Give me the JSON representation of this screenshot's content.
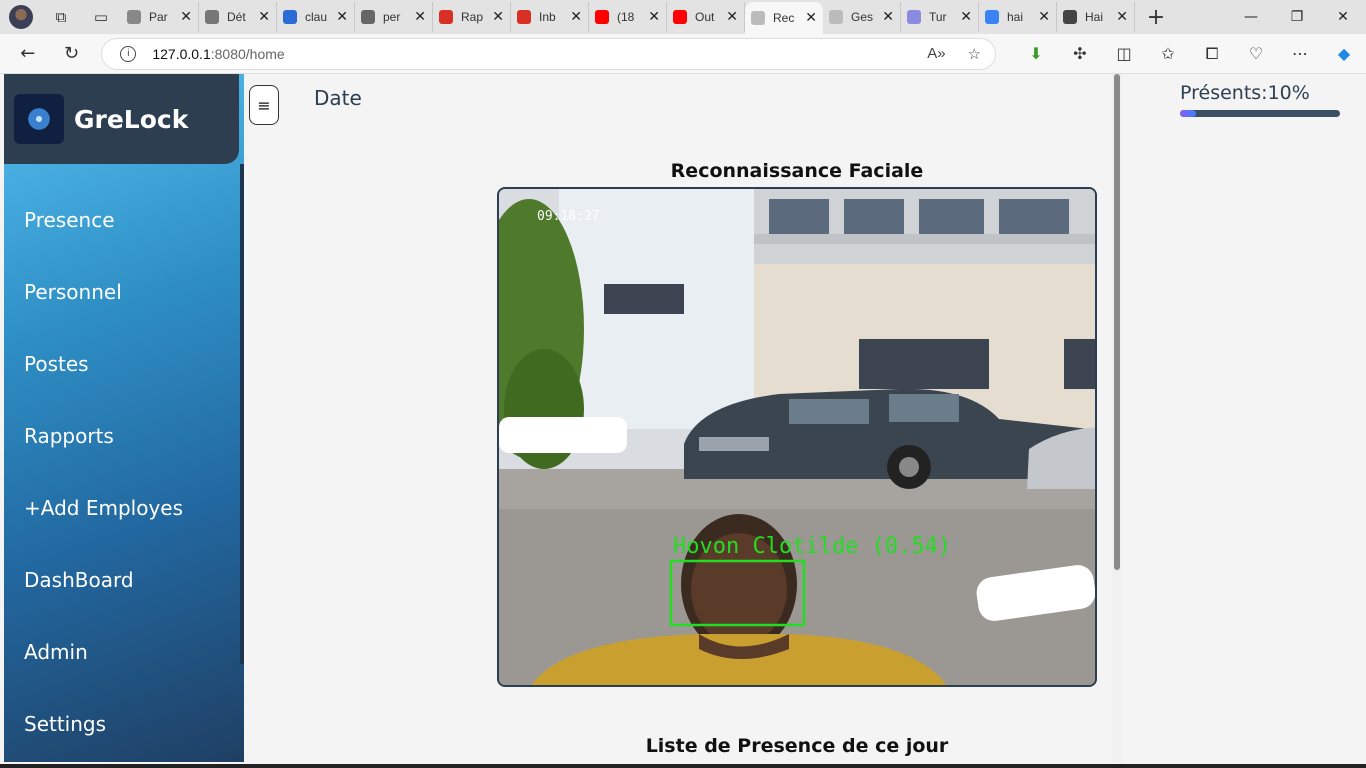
{
  "browser": {
    "tabs": [
      {
        "label": "Par",
        "fav": "#888888",
        "icon": "settings-icon"
      },
      {
        "label": "Dét",
        "fav": "#777777",
        "icon": "gear-icon"
      },
      {
        "label": "clau",
        "fav": "#2a6bd6",
        "icon": "c-logo-icon"
      },
      {
        "label": "per",
        "fav": "#666666",
        "icon": "grid-icon"
      },
      {
        "label": "Rap",
        "fav": "#d93025",
        "icon": "gmail-icon"
      },
      {
        "label": "Inb",
        "fav": "#d93025",
        "icon": "gmail-icon"
      },
      {
        "label": "(18",
        "fav": "#ff0000",
        "icon": "youtube-icon"
      },
      {
        "label": "Out",
        "fav": "#ff0000",
        "icon": "youtube-icon"
      },
      {
        "label": "Rec",
        "fav": "#bbbbbb",
        "icon": "page-icon"
      },
      {
        "label": "Ges",
        "fav": "#bbbbbb",
        "icon": "page-icon"
      },
      {
        "label": "Tur",
        "fav": "#8a8ae0",
        "icon": "turbo-icon"
      },
      {
        "label": "hai",
        "fav": "#3b82f6",
        "icon": "search-icon"
      },
      {
        "label": "Hai",
        "fav": "#444444",
        "icon": "grid-icon"
      }
    ],
    "active_tab": 8,
    "url_host": "127.0.0.1",
    "url_path": ":8080/home"
  },
  "sidebar": {
    "brand": "GreLock",
    "items": [
      {
        "label": "Presence"
      },
      {
        "label": "Personnel"
      },
      {
        "label": "Postes"
      },
      {
        "label": "Rapports"
      },
      {
        "label": "+Add Employes"
      },
      {
        "label": "DashBoard"
      },
      {
        "label": "Admin"
      },
      {
        "label": "Settings"
      }
    ]
  },
  "main": {
    "toggle_label": "≡",
    "date_label": "Date",
    "present_label": "Présents:10%",
    "present_progress": 0.1,
    "video_title": "Reconnaissance Faciale",
    "video_timestamp": "09:18:27",
    "detection_label": "Hovon Clotilde (0.54)",
    "list_title": "Liste de Presence de ce jour"
  },
  "colors": {
    "sidebar_top": "#56bff0",
    "sidebar_bottom": "#1f3f63",
    "brand_bg": "#2c3e50",
    "detection_box": "#22dd22"
  }
}
